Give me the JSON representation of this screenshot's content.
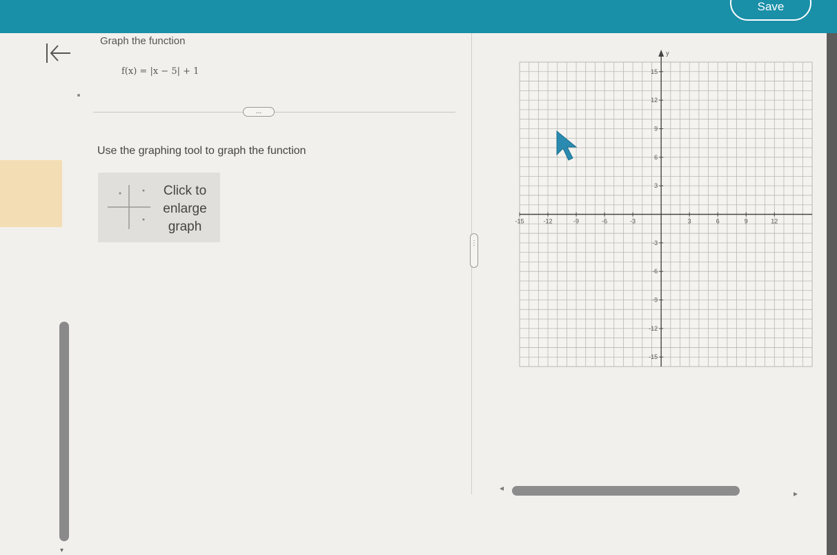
{
  "header": {
    "save_label": "Save"
  },
  "question": {
    "prompt": "Graph the function",
    "formula": "f(x) = |x − 5| + 1",
    "more_label": "...",
    "instruction": "Use the graphing tool to graph the function"
  },
  "enlarge": {
    "label_line1": "Click to",
    "label_line2": "enlarge",
    "label_line3": "graph"
  },
  "splitter": {
    "label": "⋮"
  },
  "scroll": {
    "left_arrow": "◂",
    "right_arrow": "▸",
    "down_arrow": "▾"
  },
  "icons": {
    "back": "back-arrow-icon",
    "more": "ellipsis-icon",
    "grid_thumbnail": "graph-thumbnail-icon",
    "cursor": "pointer-cursor-icon"
  },
  "colors": {
    "header": "#1a8fa8",
    "cursor": "#2b8ab0",
    "grid": "#b7b7b7",
    "axes": "#444444"
  },
  "chart_data": {
    "type": "coordinate-grid",
    "xlim": [
      -15,
      16
    ],
    "ylim": [
      -16,
      16
    ],
    "grid_step": 1,
    "x_ticks": [
      -15,
      -12,
      -9,
      -6,
      -3,
      3,
      6,
      9,
      12
    ],
    "y_ticks": [
      15,
      12,
      9,
      6,
      3,
      -3,
      -6,
      -9,
      -12,
      -15
    ],
    "x_tick_labels": [
      "-15",
      "-12",
      "-9",
      "-6",
      "-3",
      "3",
      "6",
      "9",
      "12"
    ],
    "y_tick_labels": [
      "15",
      "12",
      "9",
      "6",
      "3",
      "-3",
      "-6",
      "-9",
      "-12",
      "-15"
    ],
    "ylabel": "y",
    "plotted_series": []
  }
}
